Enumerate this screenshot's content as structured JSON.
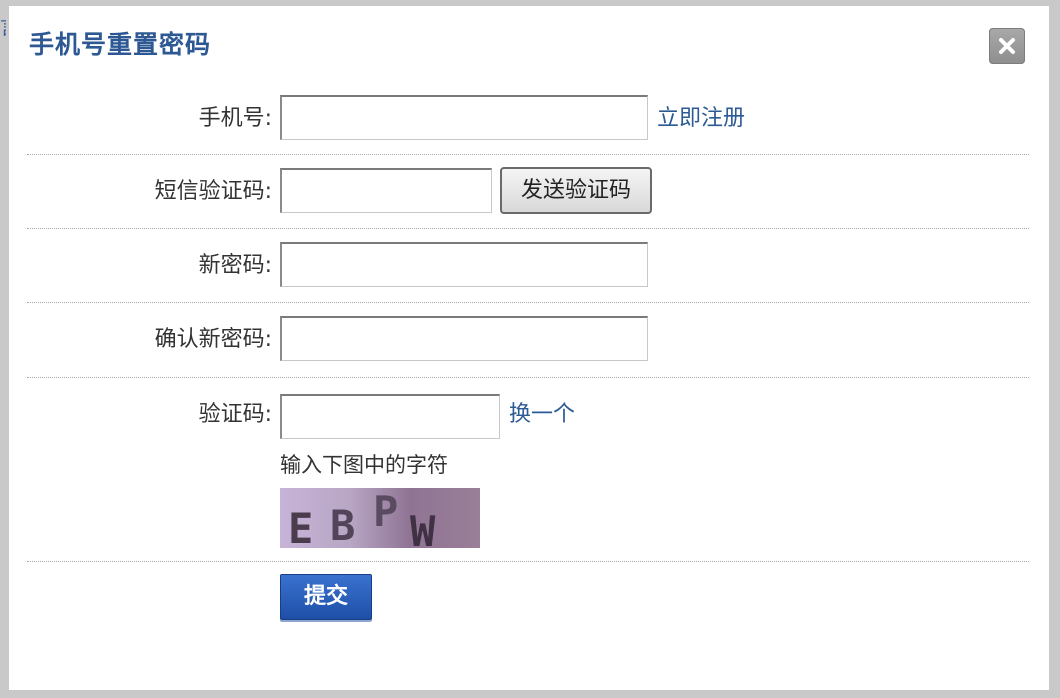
{
  "dialog": {
    "title": "手机号重置密码",
    "close_icon": "close-x-icon"
  },
  "form": {
    "phone_label": "手机号:",
    "phone_value": "",
    "register_link": "立即注册",
    "sms_code_label": "短信验证码:",
    "sms_code_value": "",
    "send_code_button": "发送验证码",
    "new_password_label": "新密码:",
    "new_password_value": "",
    "confirm_password_label": "确认新密码:",
    "confirm_password_value": "",
    "captcha_label": "验证码:",
    "captcha_value": "",
    "refresh_captcha_link": "换一个",
    "captcha_hint": "输入下图中的字符",
    "captcha_image_text": "EBPW",
    "submit_button": "提交"
  },
  "colors": {
    "title": "#2d5893",
    "link": "#2c5a94",
    "submit": "#1e4fa8",
    "captcha_bg": "#9a7fa0"
  }
}
